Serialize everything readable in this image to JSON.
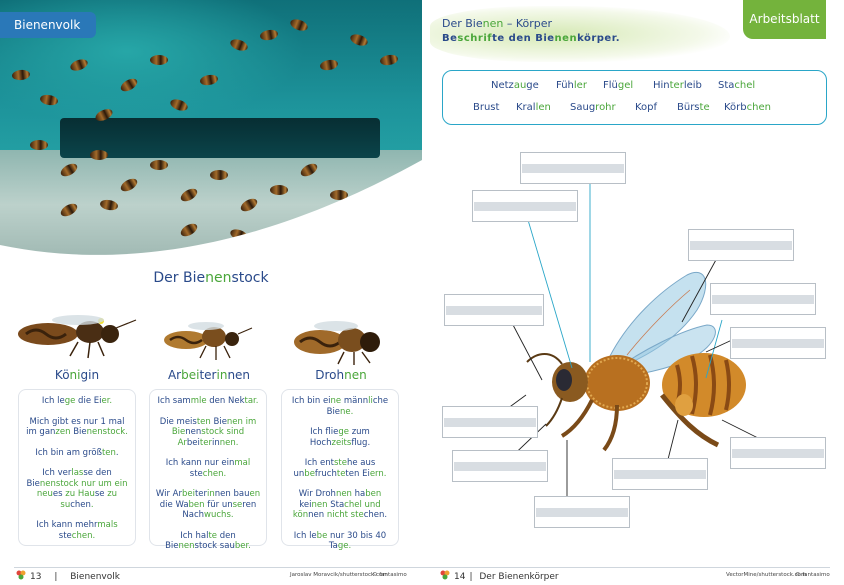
{
  "left_page": {
    "tab": "Bienenvolk",
    "section_title": {
      "a": "Der Bie",
      "b": "nen",
      "c": "stock"
    },
    "bees": [
      {
        "name": {
          "a": "Kö",
          "b": "ni",
          "c": "gin"
        },
        "lines": [
          {
            "a": "Ich le",
            "b": "ge",
            "c": " die Ei",
            "d": "er."
          },
          {
            "a": "Mich gibt es nur 1 mal im gan",
            "b": "zen",
            "c": " Bie",
            "d": "nenstock."
          },
          {
            "a": "Ich bin am größ",
            "b": "ten",
            "c": ".",
            "d": ""
          },
          {
            "a": "Ich ver",
            "b": "las",
            "c": "se den Bie",
            "d": "nenstock nur um ein neu",
            "e": "es",
            "f": " zu Hau",
            "g": "se",
            "h": " zu su",
            "i": "chen",
            "j": "."
          },
          {
            "a": "Ich kann mehr",
            "b": "mals",
            "c": " ste",
            "d": "chen."
          }
        ]
      },
      {
        "name": {
          "a": "Ar",
          "b": "bei",
          "c": "ter",
          "d": "in",
          "e": "nen"
        },
        "lines": [
          {
            "a": "Ich sam",
            "b": "mle",
            "c": " den Nek",
            "d": "tar."
          },
          {
            "a": "Die meis",
            "b": "ten",
            "c": " Bie",
            "d": "nen im Bie",
            "e": "nen",
            "f": "stock sind Ar",
            "g": "bei",
            "h": "ter",
            "i": "in",
            "j": "nen."
          },
          {
            "a": "Ich kann nur ein",
            "b": "mal",
            "c": " ste",
            "d": "chen."
          },
          {
            "a": "Wir Ar",
            "b": "bei",
            "c": "ter",
            "d": "in",
            "e": "nen bau",
            "f": "en",
            "g": " die Wa",
            "h": "ben",
            "i": " für un",
            "j": "se",
            "k": "ren Nach",
            "l": "wuchs."
          },
          {
            "a": "Ich hal",
            "b": "te",
            "c": " den Bie",
            "d": "nen",
            "e": "stock sau",
            "f": "ber."
          }
        ]
      },
      {
        "name": {
          "a": "Droh",
          "b": "nen"
        },
        "lines": [
          {
            "a": "Ich bin ei",
            "b": "ne",
            "c": " männ",
            "d": "li",
            "e": "che Bie",
            "f": "ne."
          },
          {
            "a": "Ich flie",
            "b": "ge",
            "c": " zum Hoch",
            "d": "zeits",
            "e": "flug."
          },
          {
            "a": "Ich ent",
            "b": "ste",
            "c": "he aus un",
            "d": "be",
            "e": "fruch",
            "f": "te",
            "g": "ten Ei",
            "h": "ern."
          },
          {
            "a": "Wir Droh",
            "b": "nen",
            "c": " ha",
            "d": "ben",
            "e": " kei",
            "f": "nen",
            "g": " Sta",
            "h": "chel und kön",
            "i": "nen",
            "j": " nicht ste",
            "k": "chen."
          },
          {
            "a": "Ich le",
            "b": "be",
            "c": " nur 30 bis 40 Ta",
            "d": "ge."
          }
        ]
      }
    ],
    "footer_page": "13",
    "footer_title": "Bienenvolk",
    "footer_credit": "Jaroslav Moravcik/shutterstock.com",
    "footer_brand": "© fantasimo"
  },
  "right_page": {
    "title": {
      "a": "Der Bie",
      "b": "nen",
      "c": " – Körper"
    },
    "subtitle": {
      "a": "Be",
      "b": "schrif",
      "c": "te den Bie",
      "d": "nen",
      "e": "kör",
      "f": "per."
    },
    "tab": "Arbeitsblatt",
    "words_row1": [
      {
        "a": "Netz",
        "b": "au",
        "c": "ge"
      },
      {
        "a": "Füh",
        "b": "ler",
        "c": ""
      },
      {
        "a": "Flü",
        "b": "gel",
        "c": ""
      },
      {
        "a": "Hin",
        "b": "ter",
        "c": "leib"
      },
      {
        "a": "Sta",
        "b": "chel",
        "c": ""
      }
    ],
    "words_row2": [
      {
        "a": "Brust",
        "b": "",
        "c": ""
      },
      {
        "a": "Kral",
        "b": "len",
        "c": ""
      },
      {
        "a": "Saug",
        "b": "rohr",
        "c": ""
      },
      {
        "a": "Kopf",
        "b": "",
        "c": ""
      },
      {
        "a": "Bürs",
        "b": "te",
        "c": ""
      },
      {
        "a": "Körb",
        "b": "chen",
        "c": ""
      }
    ],
    "footer_page": "14",
    "footer_title": "Der Bienenkörper",
    "footer_credit": "VectorMine/shutterstock.com",
    "footer_brand": "© fantasimo"
  },
  "colors": {
    "blue": "#2a4a8a",
    "green": "#4aa63a",
    "tab_blue": "#2a78b8",
    "tab_green": "#74b33c",
    "box_border": "#2aa6c8"
  }
}
